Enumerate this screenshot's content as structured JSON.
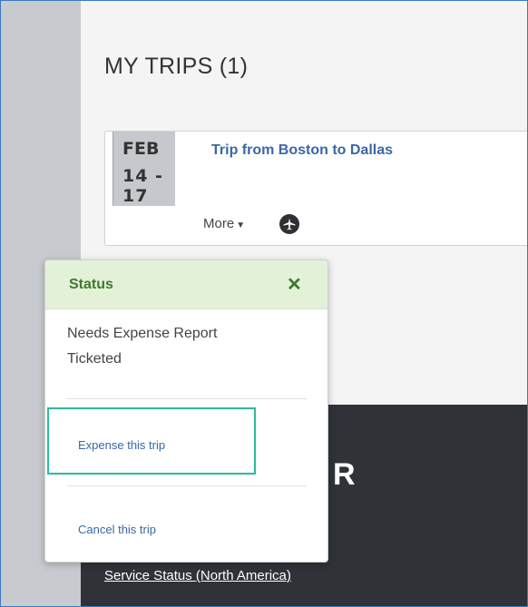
{
  "page": {
    "title": "MY TRIPS (1)"
  },
  "trip": {
    "month": "FEB",
    "days": "14 - 17",
    "title": "Trip from Boston to Dallas",
    "more_label": "More",
    "mode_icon": "airplane-icon"
  },
  "status_popover": {
    "title": "Status",
    "close_icon": "close-icon",
    "statuses": [
      "Needs Expense Report",
      "Ticketed"
    ],
    "actions": [
      "Expense this trip",
      "Cancel this trip"
    ],
    "highlight_color": "#2dbaa0"
  },
  "footer": {
    "partial_heading": "R",
    "link": "Service Status (North America)"
  },
  "colors": {
    "accent_link": "#3a67a6",
    "popover_header_bg": "#e3f1d9",
    "popover_header_text": "#3c7a2a",
    "footer_bg": "#2f3338"
  }
}
